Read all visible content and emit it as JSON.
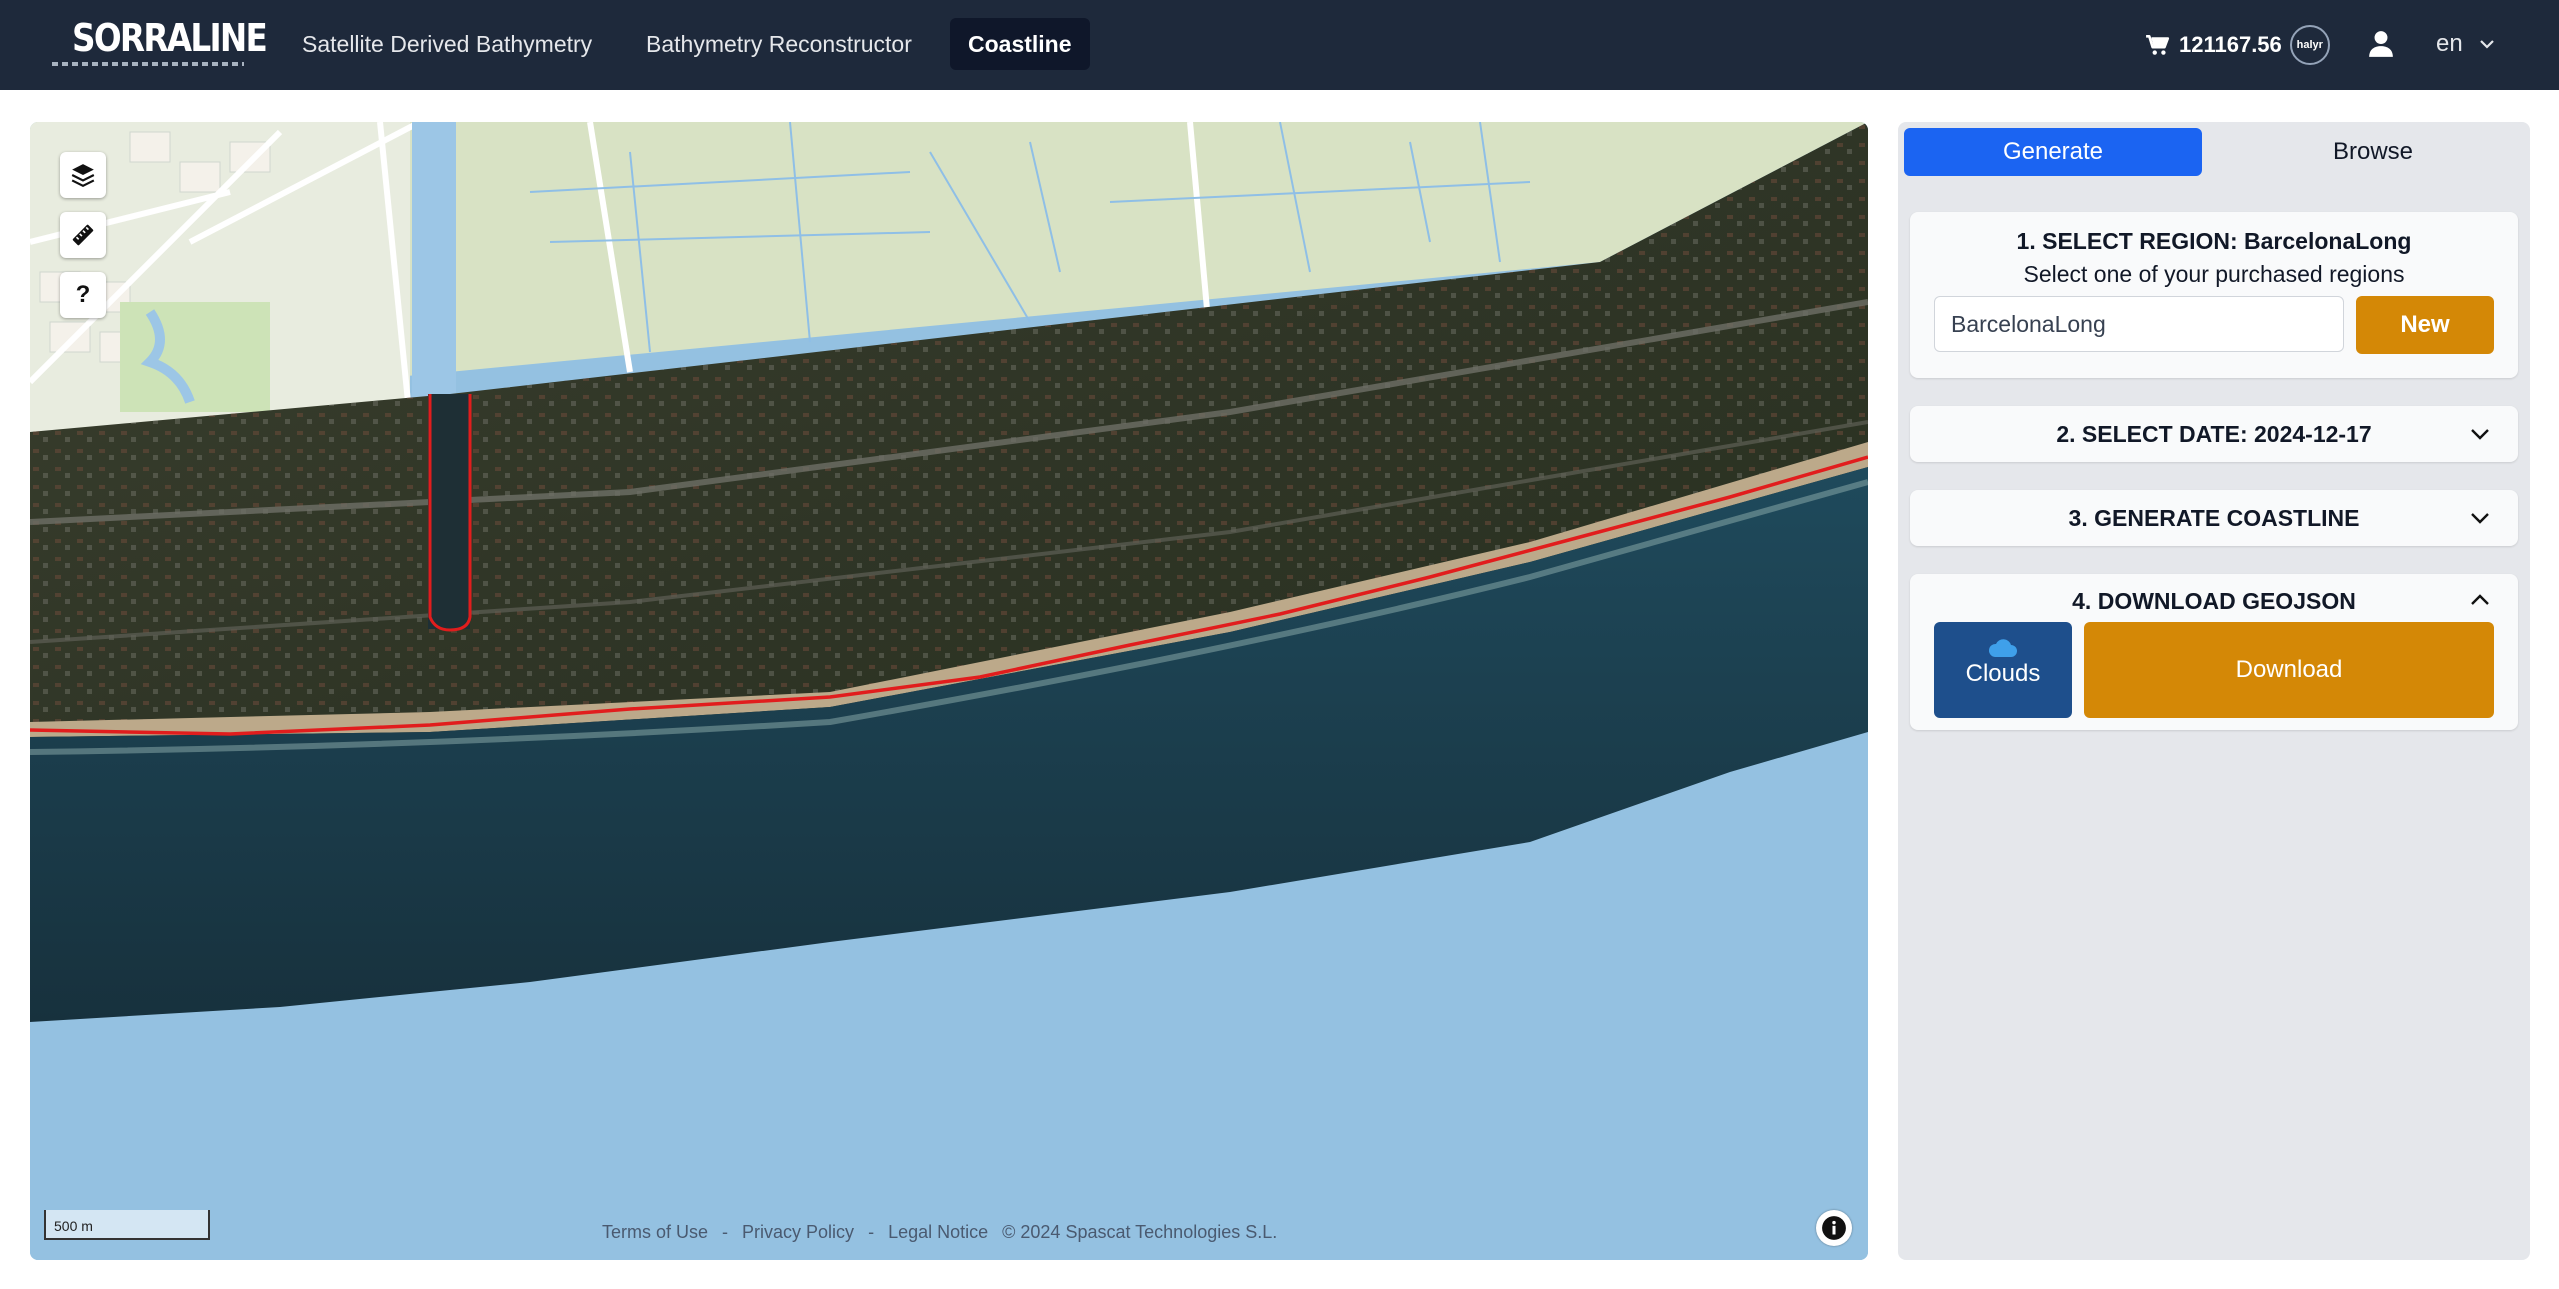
{
  "nav": {
    "logo": "SORRALINE",
    "items": [
      {
        "label": "Satellite Derived Bathymetry"
      },
      {
        "label": "Bathymetry Reconstructor"
      },
      {
        "label": "Coastline"
      }
    ],
    "credits": "121167.56",
    "coin_label": "halyr",
    "language": "en"
  },
  "map": {
    "scale_label": "500 m",
    "footer": {
      "terms": "Terms of Use",
      "sep1": "-",
      "privacy": "Privacy Policy",
      "sep2": "-",
      "legal": "Legal Notice",
      "copyright": "© 2024 Spascat Technologies S.L."
    }
  },
  "panel": {
    "tabs": {
      "generate": "Generate",
      "browse": "Browse"
    },
    "step1": {
      "title": "1. SELECT REGION: BarcelonaLong",
      "subtitle": "Select one of your purchased regions",
      "region_value": "BarcelonaLong",
      "new_label": "New"
    },
    "step2": {
      "title": "2. SELECT DATE: 2024-12-17"
    },
    "step3": {
      "title": "3. GENERATE COASTLINE"
    },
    "step4": {
      "title": "4. DOWNLOAD GEOJSON",
      "clouds_label": "Clouds",
      "download_label": "Download"
    }
  },
  "colors": {
    "nav_bg": "#1e293b",
    "primary_blue": "#1b64f2",
    "accent_orange": "#d48806",
    "clouds_blue": "#1e4f8c",
    "coastline_red": "#e11d1d",
    "sea": "#94c1e1"
  }
}
